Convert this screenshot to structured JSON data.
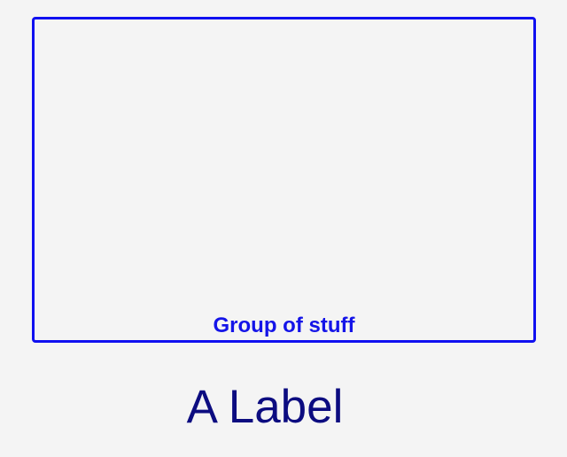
{
  "group": {
    "caption": "Group of stuff",
    "border_color": "#1010f0",
    "caption_color": "#1414e8"
  },
  "label": {
    "text": "A Label",
    "color": "#0c0c80"
  },
  "background_color": "#f4f4f4"
}
